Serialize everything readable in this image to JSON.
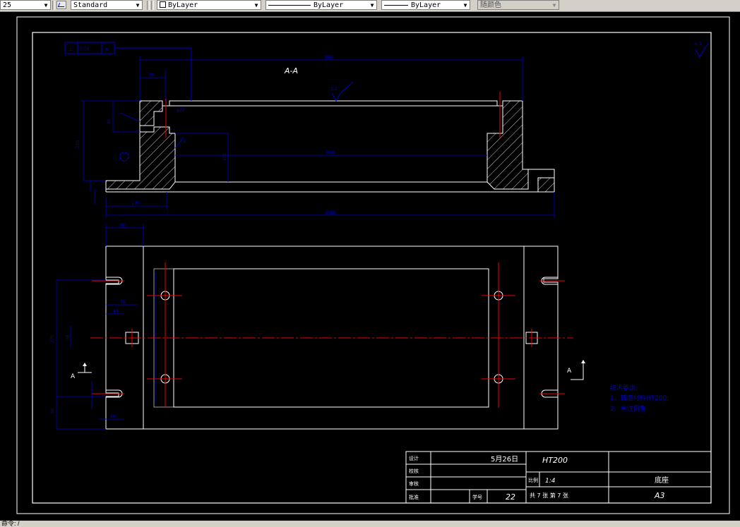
{
  "toolbar": {
    "dimstyle_value": "25",
    "textstyle_value": "Standard",
    "layer_value": "ByLayer",
    "linetype_value": "ByLayer",
    "lineweight_value": "ByLayer",
    "color_value": "随颜色"
  },
  "command_line": {
    "text": "命令: /"
  },
  "drawing": {
    "section_label": "A-A",
    "tolerance_symbol": "⊥",
    "tolerance_value": "0.04",
    "datum_label": "A",
    "roughness_main": "6.3",
    "roughness_top": "3.2",
    "roughness_side": "3.2",
    "view_marker_left": "A",
    "view_marker_right": "A",
    "dims": {
      "overall_top": "980",
      "left_offset": "70",
      "dia_small": "φ22",
      "height_total": "250",
      "height_upper": "40",
      "inner_width": "860",
      "inner_height": "100",
      "bottom_left": "170",
      "overall_bottom": "1080",
      "plan_left": "80",
      "plan_height": "270",
      "plan_slot_a": "70",
      "plan_slot_b": "44",
      "plan_center": "38",
      "plan_bottom": "90",
      "plan_small": "24"
    },
    "tech_notes": {
      "title": "技术要求:",
      "line1": "1、铸造材料HT200;",
      "line2": "2、未注倒角"
    },
    "title_block": {
      "design_label": "设计",
      "check_label": "校核",
      "review_label": "审核",
      "approve_label": "批准",
      "date": "5月26日",
      "material": "HT200",
      "scale_label": "比例",
      "scale_value": "1:4",
      "sheets_text": "共 7 张 第 7 张",
      "part_name": "底座",
      "number_label": "学号",
      "number_value": "22",
      "paper_size": "A3"
    }
  }
}
